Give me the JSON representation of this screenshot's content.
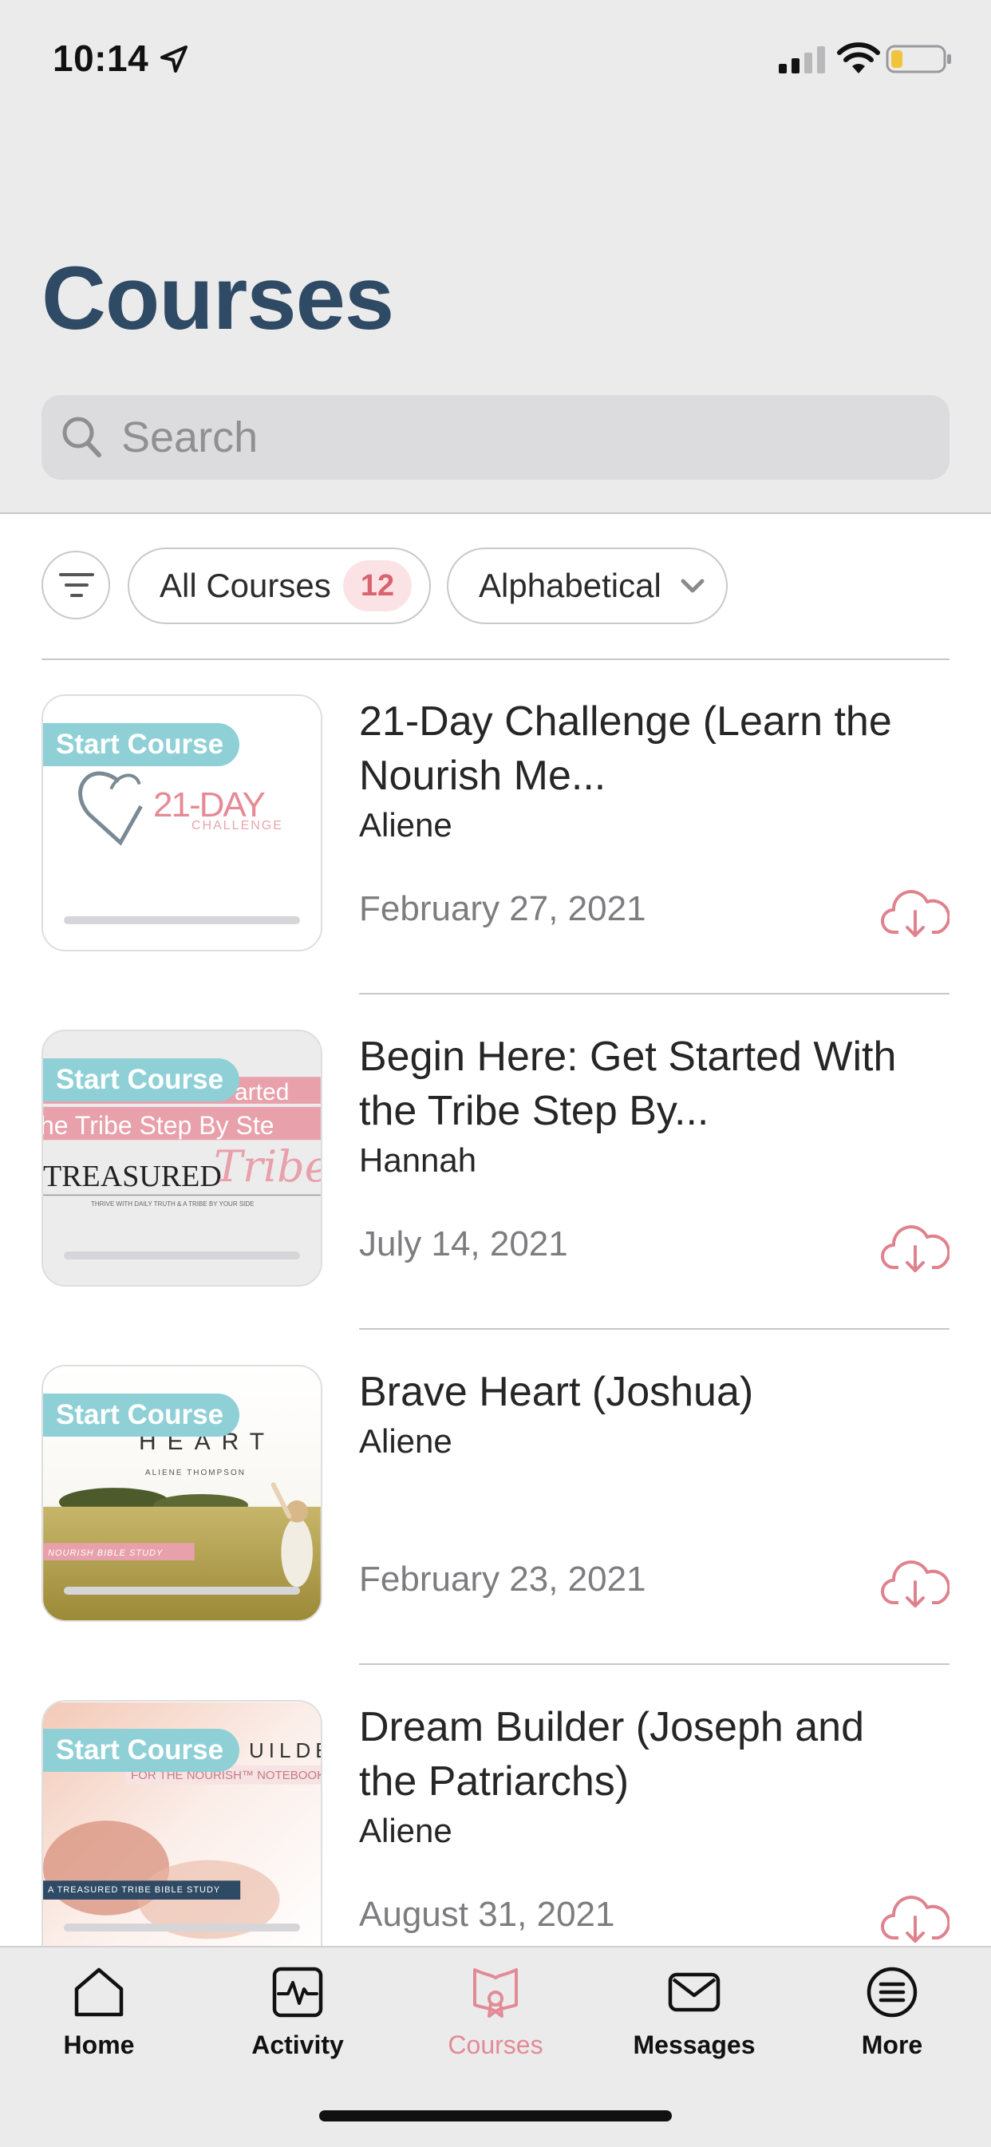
{
  "status_bar": {
    "time": "10:14",
    "icons": [
      "location-arrow-icon",
      "cellular-signal-icon",
      "wifi-icon",
      "battery-icon"
    ]
  },
  "page": {
    "title": "Courses"
  },
  "search": {
    "placeholder": "Search",
    "value": ""
  },
  "filters": {
    "filter_icon": "filter-lines-icon",
    "all_courses_label": "All Courses",
    "count": "12",
    "sort_label": "Alphabetical",
    "sort_icon": "chevron-down-icon"
  },
  "courses": [
    {
      "badge": "Start Course",
      "title": "21-Day Challenge (Learn the Nourish Me...",
      "author": "Aliene",
      "date": "February 27, 2021",
      "progress": 0,
      "thumb_text": "21-DAY",
      "thumb_subtext": "CHALLENGE"
    },
    {
      "badge": "Start Course",
      "title": "Begin Here: Get Started With the Tribe Step By...",
      "author": "Hannah",
      "date": "July 14, 2021",
      "progress": 0,
      "thumb_text_1": "arted",
      "thumb_text_2": "he Tribe Step By Ste",
      "thumb_text_3": "TREASURED",
      "thumb_text_4": "Tribe",
      "thumb_text_5": "THRIVE WITH DAILY TRUTH & A TRIBE BY YOUR SIDE"
    },
    {
      "badge": "Start Course",
      "title": "Brave Heart (Joshua)",
      "author": "Aliene",
      "date": "February 23, 2021",
      "progress": 0,
      "thumb_text_1": "HEART",
      "thumb_text_2": "ALIENE THOMPSON",
      "thumb_text_3": "NOURISH BIBLE STUDY"
    },
    {
      "badge": "Start Course",
      "title": "Dream Builder (Joseph and the Patriarchs)",
      "author": "Aliene",
      "date": "August 31, 2021",
      "progress": 0,
      "thumb_text_1": "UILDE",
      "thumb_text_2": "FOR THE NOURISH™ NOTEBOOK",
      "thumb_text_3": "A TREASURED TRIBE BIBLE STUDY"
    }
  ],
  "tabbar": {
    "tabs": [
      {
        "label": "Home",
        "icon": "home-icon",
        "active": false
      },
      {
        "label": "Activity",
        "icon": "activity-icon",
        "active": false
      },
      {
        "label": "Courses",
        "icon": "courses-icon",
        "active": true
      },
      {
        "label": "Messages",
        "icon": "envelope-icon",
        "active": false
      },
      {
        "label": "More",
        "icon": "more-list-icon",
        "active": false
      }
    ]
  },
  "colors": {
    "title": "#2f4a64",
    "accent_pink": "#e28b96",
    "badge_teal": "#8fd0d6",
    "header_bg": "#ebebec"
  }
}
